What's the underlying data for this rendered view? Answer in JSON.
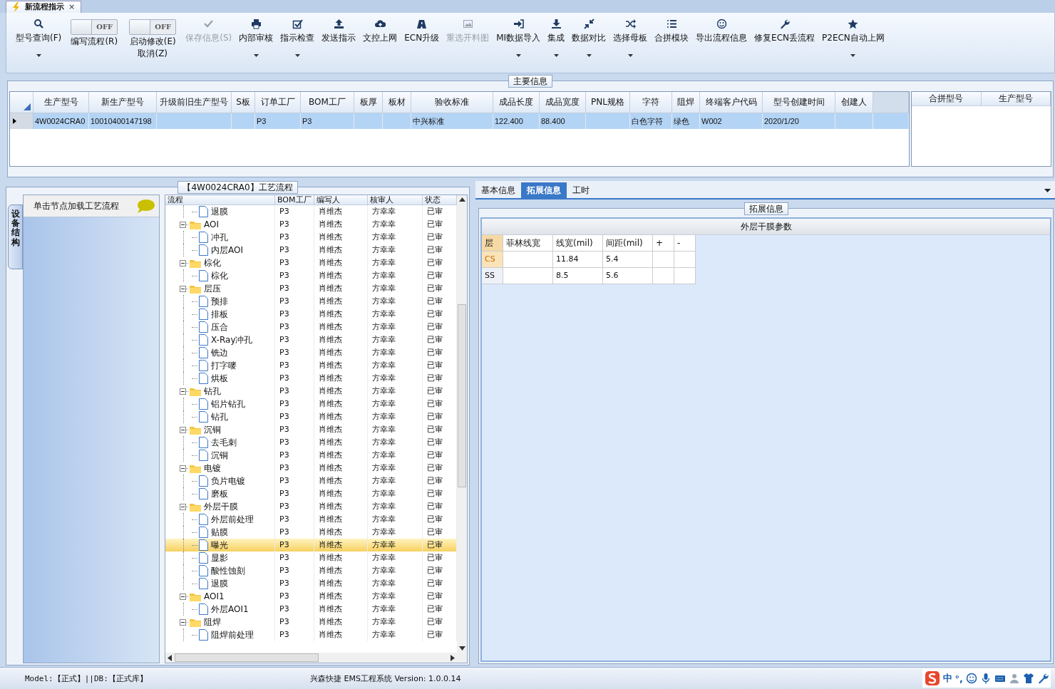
{
  "window": {
    "tab_title": "新流程指示",
    "close": "×"
  },
  "toolbar": [
    {
      "kind": "button",
      "label": "型号查询(F)",
      "disabled": false,
      "dropdown": true
    },
    {
      "kind": "toggle",
      "label": "编写流程(R)",
      "on": false,
      "state_text": "OFF"
    },
    {
      "kind": "toggle",
      "label": "启动修改(E)",
      "sublabel": "取消(Z)",
      "on": false,
      "state_text": "OFF"
    },
    {
      "kind": "button",
      "label": "保存信息(S)",
      "disabled": true,
      "dropdown": false
    },
    {
      "kind": "button",
      "label": "内部审核",
      "disabled": false,
      "dropdown": true
    },
    {
      "kind": "button",
      "label": "指示检查",
      "disabled": false,
      "dropdown": true
    },
    {
      "kind": "button",
      "label": "发送指示",
      "disabled": false,
      "dropdown": false
    },
    {
      "kind": "button",
      "label": "文控上网",
      "disabled": false,
      "dropdown": false
    },
    {
      "kind": "button",
      "label": "ECN升级",
      "disabled": false,
      "dropdown": false
    },
    {
      "kind": "button",
      "label": "重选开料图",
      "disabled": true,
      "dropdown": false
    },
    {
      "kind": "button",
      "label": "MI数据导入",
      "disabled": false,
      "dropdown": true
    },
    {
      "kind": "button",
      "label": "集成",
      "disabled": false,
      "dropdown": true
    },
    {
      "kind": "button",
      "label": "数据对比",
      "disabled": false,
      "dropdown": true
    },
    {
      "kind": "button",
      "label": "选择母板",
      "disabled": false,
      "dropdown": true
    },
    {
      "kind": "button",
      "label": "合拼模块",
      "disabled": false,
      "dropdown": false
    },
    {
      "kind": "button",
      "label": "导出流程信息",
      "disabled": false,
      "dropdown": false
    },
    {
      "kind": "button",
      "label": "修复ECN丢流程",
      "disabled": false,
      "dropdown": false
    },
    {
      "kind": "button",
      "label": "P2ECN自动上网",
      "disabled": false,
      "dropdown": true
    }
  ],
  "main_info": {
    "title": "主要信息",
    "table": {
      "columns": [
        "生产型号",
        "新生产型号",
        "升级前旧生产型号",
        "S板",
        "订单工厂",
        "BOM工厂",
        "板厚",
        "板材",
        "验收标准",
        "成品长度",
        "成品宽度",
        "PNL规格",
        "字符",
        "阻焊",
        "终端客户代码",
        "型号创建时间",
        "创建人"
      ],
      "rows": [
        {
          "selected": true,
          "cells": [
            "4W0024CRA0",
            "10010400147198",
            "",
            "",
            "P3",
            "P3",
            "",
            "",
            "中兴标准",
            "122.400",
            "88.400",
            "",
            "白色字符",
            "绿色",
            "W002",
            "2020/1/20",
            ""
          ]
        }
      ]
    },
    "side_table": {
      "columns": [
        "合拼型号",
        "生产型号"
      ]
    }
  },
  "process": {
    "title": "【4W0024CRA0】工艺流程",
    "side_tab": "设备结构",
    "hint": "单击节点加载工艺流程",
    "columns": [
      "流程",
      "BOM工厂",
      "编写人",
      "核审人",
      "状态"
    ],
    "tree": [
      {
        "children": [
          {
            "label": "退膜",
            "bom": "P3",
            "writer": "肖维杰",
            "reviewer": "方幸幸",
            "status": "已审",
            "selected": false
          }
        ]
      },
      {
        "label": "AOI",
        "bom": "P3",
        "writer": "肖维杰",
        "reviewer": "方幸幸",
        "status": "已审",
        "selected": false,
        "expanded": true,
        "children": [
          {
            "label": "冲孔",
            "bom": "P3",
            "writer": "肖维杰",
            "reviewer": "方幸幸",
            "status": "已审",
            "selected": false
          },
          {
            "label": "内层AOI",
            "bom": "P3",
            "writer": "肖维杰",
            "reviewer": "方幸幸",
            "status": "已审",
            "selected": false
          }
        ]
      },
      {
        "label": "棕化",
        "bom": "P3",
        "writer": "肖维杰",
        "reviewer": "方幸幸",
        "status": "已审",
        "selected": false,
        "expanded": true,
        "children": [
          {
            "label": "棕化",
            "bom": "P3",
            "writer": "肖维杰",
            "reviewer": "方幸幸",
            "status": "已审",
            "selected": false
          }
        ]
      },
      {
        "label": "层压",
        "bom": "P3",
        "writer": "肖维杰",
        "reviewer": "方幸幸",
        "status": "已审",
        "selected": false,
        "expanded": true,
        "children": [
          {
            "label": "预排",
            "bom": "P3",
            "writer": "肖维杰",
            "reviewer": "方幸幸",
            "status": "已审",
            "selected": false
          },
          {
            "label": "排板",
            "bom": "P3",
            "writer": "肖维杰",
            "reviewer": "方幸幸",
            "status": "已审",
            "selected": false
          },
          {
            "label": "压合",
            "bom": "P3",
            "writer": "肖维杰",
            "reviewer": "方幸幸",
            "status": "已审",
            "selected": false
          },
          {
            "label": "X-Ray冲孔",
            "bom": "P3",
            "writer": "肖维杰",
            "reviewer": "方幸幸",
            "status": "已审",
            "selected": false
          },
          {
            "label": "铣边",
            "bom": "P3",
            "writer": "肖维杰",
            "reviewer": "方幸幸",
            "status": "已审",
            "selected": false
          },
          {
            "label": "打字嘜",
            "bom": "P3",
            "writer": "肖维杰",
            "reviewer": "方幸幸",
            "status": "已审",
            "selected": false
          },
          {
            "label": "烘板",
            "bom": "P3",
            "writer": "肖维杰",
            "reviewer": "方幸幸",
            "status": "已审",
            "selected": false
          }
        ]
      },
      {
        "label": "钻孔",
        "bom": "P3",
        "writer": "肖维杰",
        "reviewer": "方幸幸",
        "status": "已审",
        "selected": false,
        "expanded": true,
        "children": [
          {
            "label": "铝片钻孔",
            "bom": "P3",
            "writer": "肖维杰",
            "reviewer": "方幸幸",
            "status": "已审",
            "selected": false
          },
          {
            "label": "钻孔",
            "bom": "P3",
            "writer": "肖维杰",
            "reviewer": "方幸幸",
            "status": "已审",
            "selected": false
          }
        ]
      },
      {
        "label": "沉铜",
        "bom": "P3",
        "writer": "肖维杰",
        "reviewer": "方幸幸",
        "status": "已审",
        "selected": false,
        "expanded": true,
        "children": [
          {
            "label": "去毛刺",
            "bom": "P3",
            "writer": "肖维杰",
            "reviewer": "方幸幸",
            "status": "已审",
            "selected": false
          },
          {
            "label": "沉铜",
            "bom": "P3",
            "writer": "肖维杰",
            "reviewer": "方幸幸",
            "status": "已审",
            "selected": false
          }
        ]
      },
      {
        "label": "电镀",
        "bom": "P3",
        "writer": "肖维杰",
        "reviewer": "方幸幸",
        "status": "已审",
        "selected": false,
        "expanded": true,
        "children": [
          {
            "label": "负片电镀",
            "bom": "P3",
            "writer": "肖维杰",
            "reviewer": "方幸幸",
            "status": "已审",
            "selected": false
          },
          {
            "label": "磨板",
            "bom": "P3",
            "writer": "肖维杰",
            "reviewer": "方幸幸",
            "status": "已审",
            "selected": false
          }
        ]
      },
      {
        "label": "外层干膜",
        "bom": "P3",
        "writer": "肖维杰",
        "reviewer": "方幸幸",
        "status": "已审",
        "selected": false,
        "expanded": true,
        "children": [
          {
            "label": "外层前处理",
            "bom": "P3",
            "writer": "肖维杰",
            "reviewer": "方幸幸",
            "status": "已审",
            "selected": false
          },
          {
            "label": "贴膜",
            "bom": "P3",
            "writer": "肖维杰",
            "reviewer": "方幸幸",
            "status": "已审",
            "selected": false
          },
          {
            "label": "曝光",
            "bom": "P3",
            "writer": "肖维杰",
            "reviewer": "方幸幸",
            "status": "已审",
            "selected": true
          },
          {
            "label": "显影",
            "bom": "P3",
            "writer": "肖维杰",
            "reviewer": "方幸幸",
            "status": "已审",
            "selected": false
          },
          {
            "label": "酸性蚀刻",
            "bom": "P3",
            "writer": "肖维杰",
            "reviewer": "方幸幸",
            "status": "已审",
            "selected": false
          },
          {
            "label": "退膜",
            "bom": "P3",
            "writer": "肖维杰",
            "reviewer": "方幸幸",
            "status": "已审",
            "selected": false
          }
        ]
      },
      {
        "label": "AOI1",
        "bom": "P3",
        "writer": "肖维杰",
        "reviewer": "方幸幸",
        "status": "已审",
        "selected": false,
        "expanded": true,
        "children": [
          {
            "label": "外层AOI1",
            "bom": "P3",
            "writer": "肖维杰",
            "reviewer": "方幸幸",
            "status": "已审",
            "selected": false
          }
        ]
      },
      {
        "label": "阻焊",
        "bom": "P3",
        "writer": "肖维杰",
        "reviewer": "方幸幸",
        "status": "已审",
        "selected": false,
        "expanded": true,
        "children": [
          {
            "label": "阻焊前处理",
            "bom": "P3",
            "writer": "肖维杰",
            "reviewer": "方幸幸",
            "status": "已审",
            "selected": false
          }
        ]
      }
    ]
  },
  "detail": {
    "tabs": [
      {
        "label": "基本信息",
        "selected": false
      },
      {
        "label": "拓展信息",
        "selected": true
      },
      {
        "label": "工时",
        "selected": false
      }
    ],
    "group_title": "拓展信息",
    "panel_title": "外层干膜参数",
    "grid": {
      "columns": [
        "层",
        "菲林线宽",
        "线宽(mil)",
        "间距(mil)",
        "+",
        "-"
      ],
      "rows": [
        {
          "current": true,
          "cells": [
            "CS",
            "",
            "11.84",
            "5.4",
            "",
            ""
          ]
        },
        {
          "current": false,
          "cells": [
            "SS",
            "",
            "8.5",
            "5.6",
            "",
            ""
          ]
        }
      ]
    }
  },
  "status_bar": {
    "left": "Model:【正式】||DB:【正式库】",
    "center": "兴森快捷 EMS工程系统 Version: 1.0.0.14",
    "tray": [
      "中",
      "°,"
    ]
  }
}
